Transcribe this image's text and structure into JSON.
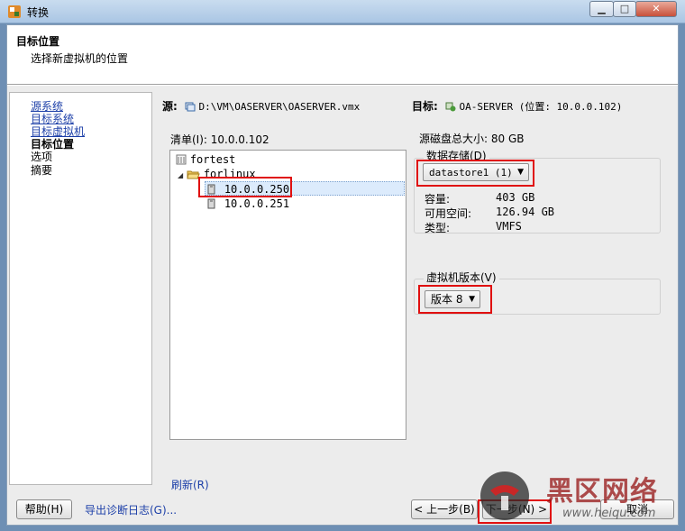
{
  "window": {
    "title": "转换",
    "close_glyph": "✕",
    "min_glyph": "▁",
    "max_glyph": "□"
  },
  "header": {
    "title": "目标位置",
    "subtitle": "选择新虚拟机的位置"
  },
  "nav": {
    "items": [
      {
        "label": "源系统",
        "state": "link"
      },
      {
        "label": "目标系统",
        "state": "link"
      },
      {
        "label": "目标虚拟机",
        "state": "link"
      },
      {
        "label": "目标位置",
        "state": "current"
      },
      {
        "label": "选项",
        "state": "pending"
      },
      {
        "label": "摘要",
        "state": "pending"
      }
    ]
  },
  "source": {
    "label": "源:",
    "value": "D:\\VM\\OASERVER\\OASERVER.vmx",
    "icon": "vm-file-icon"
  },
  "target": {
    "label": "目标:",
    "value": "OA-SERVER (位置: 10.0.0.102)",
    "icon": "vm-target-icon"
  },
  "inventory": {
    "label": "清单(I): 10.0.0.102",
    "tree": [
      {
        "label": "fortest",
        "icon": "datacenter-icon",
        "expanded": false
      },
      {
        "label": "forlinux",
        "icon": "folder-icon",
        "expanded": true
      },
      {
        "label": "10.0.0.250",
        "icon": "host-icon",
        "selected": true
      },
      {
        "label": "10.0.0.251",
        "icon": "host-icon",
        "selected": false
      }
    ],
    "refresh_label": "刷新(R)"
  },
  "disk": {
    "size_label": "源磁盘总大小: 80 GB"
  },
  "datastore": {
    "group_label": "数据存储(D)",
    "selected": "datastore1 (1)",
    "capacity_label": "容量:",
    "capacity_value": "403 GB",
    "free_label": "可用空间:",
    "free_value": "126.94 GB",
    "type_label": "类型:",
    "type_value": "VMFS"
  },
  "vm_version": {
    "group_label": "虚拟机版本(V)",
    "selected": "版本 8"
  },
  "footer": {
    "help": "帮助(H)",
    "export_logs": "导出诊断日志(G)...",
    "back": "< 上一步(B)",
    "next": "下一步(N) >",
    "cancel": "取消"
  },
  "watermark": {
    "text": "黑区网络",
    "url": "www.heiqu.com"
  },
  "colors": {
    "highlight_box": "#e01010",
    "link": "#1c3fa8",
    "titlebar": "#b6cfe8"
  }
}
